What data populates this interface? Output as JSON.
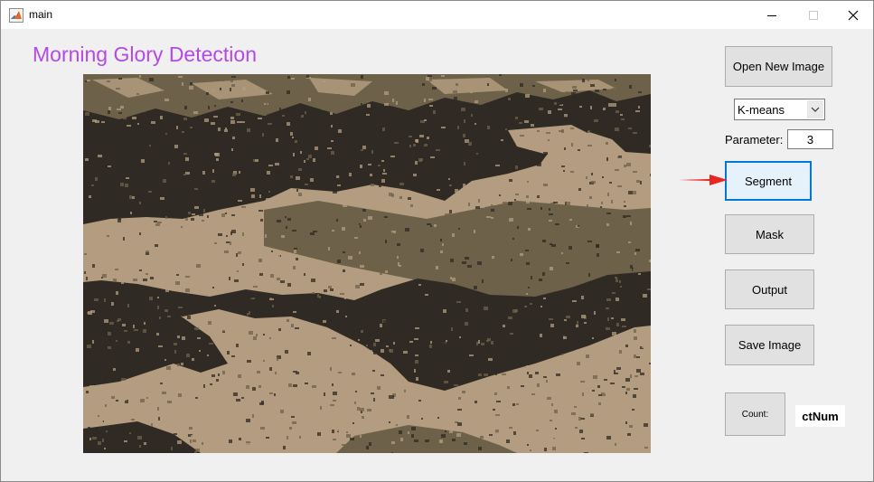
{
  "window": {
    "title": "main",
    "icon": "matlab-icon",
    "controls": [
      "minimize-icon",
      "maximize-icon",
      "close-icon"
    ]
  },
  "app": {
    "title": "Morning Glory Detection",
    "title_color": "#b44ae6"
  },
  "image": {
    "description_icon": "segmented-image",
    "colors": {
      "dark": "#2f2a23",
      "mid": "#6d6249",
      "light": "#b39c7f"
    }
  },
  "controls": {
    "open_button": "Open New Image",
    "method_select": {
      "value": "K-means"
    },
    "parameter_label": "Parameter:",
    "parameter_value": "3",
    "segment_button": "Segment",
    "mask_button": "Mask",
    "output_button": "Output",
    "save_button": "Save Image",
    "count_button": "Count:",
    "count_value": "ctNum"
  },
  "annotation": {
    "arrow_color": "#e8251f"
  }
}
